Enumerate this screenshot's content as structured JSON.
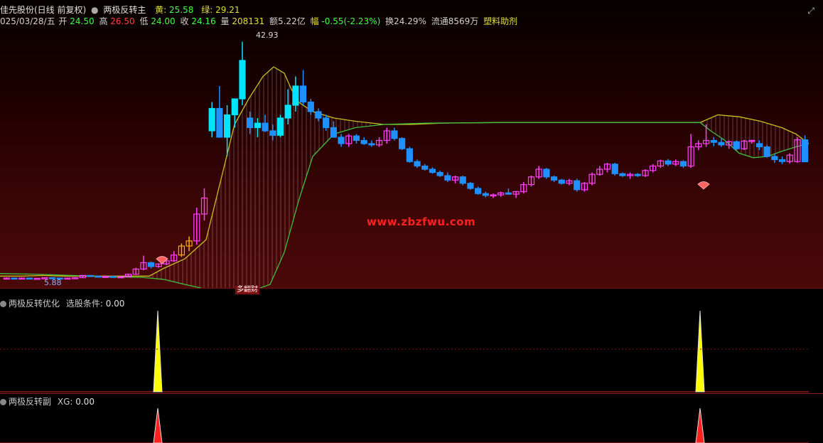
{
  "header": {
    "stock_name": "佳先股份(日线 前复权)",
    "indicator_name": "两极反转主",
    "yellow_label": "黄:",
    "yellow_value": "25.58",
    "green_label": "绿:",
    "green_value": "29.21",
    "date": "025/03/28/五",
    "open_label": "开",
    "open_value": "24.50",
    "high_label": "高",
    "high_value": "26.50",
    "low_label": "低",
    "low_value": "24.00",
    "close_label": "收",
    "close_value": "24.16",
    "volume_label": "量",
    "volume_value": "208131",
    "amount_text": "额5.22亿",
    "change_label": "幅",
    "change_value": "-0.55(-2.23%)",
    "turnover_text": "换24.29%",
    "float_text": "流通8569万",
    "sector_text": "塑料助剂"
  },
  "annotations": {
    "price_high": "42.93",
    "price_low": "5.88",
    "watermark": "www.zbzfwu.com",
    "logo": "多翻财"
  },
  "panels": {
    "osc1_name": "两极反转优化",
    "osc1_label": "选股条件:",
    "osc1_value": "0.00",
    "osc2_name": "两极反转副",
    "osc2_label": "XG:",
    "osc2_value": "0.00"
  },
  "colors": {
    "up": "#ff40ff",
    "up_cyan": "#00e5ff",
    "down": "#1e90ff",
    "yellow_line": "#c8c020",
    "green_line": "#40c040",
    "stripe": "#d9a0a0",
    "spike_yellow": "#ffff00",
    "spike_red": "#ff2020",
    "base_red": "#b02020"
  },
  "chart_data": {
    "type": "candlestick",
    "y_range": [
      5.0,
      45.0
    ],
    "candles": [
      [
        7,
        5.9,
        6.1,
        5.9,
        6.0
      ],
      [
        7,
        6.0,
        6.0,
        5.9,
        5.95
      ],
      [
        7,
        5.95,
        6.05,
        5.9,
        6.0
      ],
      [
        7,
        6.0,
        6.0,
        5.85,
        5.9
      ],
      [
        7,
        5.9,
        6.0,
        5.88,
        5.95
      ],
      [
        7,
        5.95,
        6.1,
        5.9,
        6.05
      ],
      [
        7,
        6.05,
        6.1,
        5.95,
        6.0
      ],
      [
        7,
        6.0,
        6.05,
        5.9,
        5.95
      ],
      [
        7,
        5.95,
        6.0,
        5.9,
        6.0
      ],
      [
        7,
        6.0,
        6.1,
        5.95,
        6.05
      ],
      [
        7,
        6.05,
        6.5,
        6.0,
        6.4
      ],
      [
        7,
        6.4,
        6.45,
        6.2,
        6.3
      ],
      [
        7,
        6.3,
        6.35,
        6.1,
        6.2
      ],
      [
        7,
        6.2,
        6.3,
        6.1,
        6.25
      ],
      [
        7,
        6.25,
        6.3,
        6.1,
        6.15
      ],
      [
        7,
        6.15,
        6.25,
        6.05,
        6.2
      ],
      [
        7,
        6.2,
        6.7,
        6.15,
        6.6
      ],
      [
        7,
        6.6,
        7.6,
        6.5,
        7.4
      ],
      [
        7,
        7.4,
        9.5,
        7.2,
        8.4
      ],
      [
        7,
        8.4,
        8.6,
        7.5,
        7.8
      ],
      [
        7,
        7.8,
        8.3,
        7.6,
        8.2
      ],
      [
        7,
        8.2,
        8.9,
        8.0,
        8.7
      ],
      [
        7,
        8.7,
        10.2,
        8.5,
        9.6
      ],
      [
        7,
        9.6,
        11.4,
        9.3,
        11.0
      ],
      [
        7,
        11.0,
        12.5,
        10.2,
        11.8
      ],
      [
        7,
        11.8,
        17.0,
        11.2,
        16.0
      ],
      [
        7,
        16.0,
        20.0,
        15.0,
        18.5
      ],
      [
        7,
        29.0,
        33.5,
        28.0,
        32.5
      ],
      [
        7,
        32.5,
        36.0,
        30.0,
        28.0
      ],
      [
        7,
        28.0,
        33.0,
        25.0,
        31.5
      ],
      [
        7,
        31.5,
        34.0,
        29.5,
        34.0
      ],
      [
        7,
        34.0,
        42.93,
        33.0,
        40.0
      ],
      [
        7,
        31.0,
        32.0,
        28.5,
        29.5
      ],
      [
        7,
        29.5,
        31.0,
        28.0,
        30.2
      ],
      [
        7,
        30.2,
        31.5,
        28.8,
        29.0
      ],
      [
        7,
        29.0,
        30.0,
        27.5,
        28.3
      ],
      [
        7,
        28.3,
        31.5,
        28.0,
        31.0
      ],
      [
        7,
        31.0,
        35.5,
        30.0,
        33.0
      ],
      [
        7,
        33.0,
        37.5,
        32.0,
        36.0
      ],
      [
        7,
        36.0,
        38.5,
        33.0,
        33.5
      ],
      [
        7,
        33.5,
        34.0,
        31.5,
        32.0
      ],
      [
        7,
        32.0,
        32.5,
        30.5,
        31.0
      ],
      [
        7,
        31.0,
        31.5,
        29.0,
        29.5
      ],
      [
        7,
        29.5,
        30.5,
        28.0,
        28.0
      ],
      [
        7,
        28.0,
        28.5,
        26.5,
        27.0
      ],
      [
        7,
        27.0,
        28.5,
        26.5,
        28.2
      ],
      [
        7,
        28.2,
        28.5,
        27.0,
        27.5
      ],
      [
        7,
        27.5,
        28.0,
        26.8,
        27.0
      ],
      [
        7,
        27.0,
        27.5,
        26.5,
        26.8
      ],
      [
        7,
        26.8,
        28.0,
        26.5,
        27.5
      ],
      [
        7,
        27.5,
        29.5,
        27.0,
        29.0
      ],
      [
        7,
        29.0,
        29.5,
        27.5,
        27.8
      ],
      [
        7,
        27.8,
        28.0,
        26.0,
        26.2
      ],
      [
        7,
        26.2,
        26.5,
        24.0,
        24.2
      ],
      [
        7,
        24.2,
        24.5,
        23.2,
        23.5
      ],
      [
        7,
        23.5,
        23.8,
        22.8,
        23.0
      ],
      [
        7,
        23.0,
        23.3,
        22.3,
        22.5
      ],
      [
        7,
        22.5,
        22.8,
        21.8,
        22.0
      ],
      [
        7,
        22.0,
        22.5,
        21.0,
        21.3
      ],
      [
        7,
        21.3,
        22.0,
        20.8,
        21.8
      ],
      [
        7,
        21.8,
        22.0,
        20.5,
        20.8
      ],
      [
        7,
        20.8,
        21.0,
        19.8,
        20.0
      ],
      [
        7,
        20.0,
        20.3,
        19.0,
        19.2
      ],
      [
        7,
        19.2,
        19.5,
        18.6,
        18.9
      ],
      [
        7,
        18.9,
        19.2,
        18.5,
        19.0
      ],
      [
        7,
        19.0,
        19.5,
        18.7,
        19.3
      ],
      [
        7,
        19.3,
        20.0,
        19.0,
        19.1
      ],
      [
        7,
        19.1,
        19.6,
        18.5,
        19.5
      ],
      [
        7,
        19.5,
        21.0,
        19.2,
        20.6
      ],
      [
        7,
        20.6,
        22.0,
        20.3,
        21.8
      ],
      [
        7,
        21.8,
        23.5,
        21.5,
        23.0
      ],
      [
        7,
        23.0,
        23.2,
        21.5,
        21.8
      ],
      [
        7,
        21.8,
        22.0,
        21.0,
        21.3
      ],
      [
        7,
        21.3,
        21.5,
        20.6,
        20.8
      ],
      [
        7,
        20.8,
        21.5,
        20.5,
        21.2
      ],
      [
        7,
        21.2,
        21.5,
        19.5,
        19.8
      ],
      [
        7,
        19.8,
        21.0,
        19.5,
        20.8
      ],
      [
        7,
        20.8,
        22.5,
        20.5,
        22.2
      ],
      [
        7,
        22.2,
        23.5,
        22.0,
        23.0
      ],
      [
        7,
        23.0,
        24.0,
        22.5,
        23.8
      ],
      [
        7,
        23.8,
        24.0,
        22.0,
        22.3
      ],
      [
        7,
        22.3,
        22.5,
        21.8,
        22.0
      ],
      [
        7,
        22.0,
        22.5,
        21.5,
        22.2
      ],
      [
        7,
        22.2,
        22.4,
        21.8,
        22.0
      ],
      [
        7,
        22.0,
        23.0,
        21.8,
        22.8
      ],
      [
        7,
        22.8,
        23.8,
        22.5,
        23.5
      ],
      [
        7,
        23.5,
        24.5,
        23.2,
        24.3
      ],
      [
        7,
        24.3,
        24.6,
        23.5,
        23.8
      ],
      [
        7,
        23.8,
        24.5,
        23.5,
        24.2
      ],
      [
        7,
        24.2,
        24.4,
        23.2,
        23.5
      ],
      [
        7,
        23.5,
        28.5,
        23.2,
        26.5
      ],
      [
        7,
        26.5,
        27.5,
        26.0,
        27.0
      ],
      [
        7,
        27.0,
        30.0,
        26.5,
        27.5
      ],
      [
        7,
        27.5,
        28.0,
        26.6,
        27.2
      ],
      [
        7,
        27.2,
        27.8,
        26.5,
        26.8
      ],
      [
        7,
        26.8,
        27.5,
        26.2,
        27.3
      ],
      [
        7,
        27.3,
        27.5,
        26.0,
        26.2
      ],
      [
        7,
        26.2,
        27.6,
        26.0,
        27.4
      ],
      [
        7,
        27.4,
        27.6,
        27.0,
        27.5
      ],
      [
        7,
        27.0,
        27.5,
        26.0,
        26.5
      ],
      [
        7,
        26.5,
        26.8,
        24.8,
        25.0
      ],
      [
        7,
        25.0,
        25.5,
        24.0,
        24.5
      ],
      [
        7,
        24.5,
        25.0,
        23.8,
        24.2
      ],
      [
        7,
        24.2,
        25.5,
        23.9,
        25.2
      ],
      [
        7,
        24.2,
        28.0,
        24.0,
        27.6
      ],
      [
        7,
        27.6,
        28.3,
        25.0,
        24.16
      ]
    ],
    "yellow_line": [
      [
        0,
        6.3
      ],
      [
        30,
        6.3
      ],
      [
        60,
        6.4
      ],
      [
        90,
        6.3
      ],
      [
        120,
        6.3
      ],
      [
        150,
        6.3
      ],
      [
        180,
        6.3
      ],
      [
        210,
        6.3
      ],
      [
        230,
        7.5
      ],
      [
        260,
        9.0
      ],
      [
        290,
        12.0
      ],
      [
        310,
        21.0
      ],
      [
        330,
        30.0
      ],
      [
        350,
        34.0
      ],
      [
        370,
        37.5
      ],
      [
        385,
        39.0
      ],
      [
        400,
        38.0
      ],
      [
        410,
        35.5
      ],
      [
        420,
        33.5
      ],
      [
        440,
        32.0
      ],
      [
        470,
        31.0
      ],
      [
        500,
        30.5
      ],
      [
        540,
        30.0
      ],
      [
        580,
        30.0
      ],
      [
        620,
        30.2
      ],
      [
        700,
        30.3
      ],
      [
        800,
        30.3
      ],
      [
        900,
        30.3
      ],
      [
        985,
        30.3
      ],
      [
        1010,
        31.5
      ],
      [
        1040,
        31.2
      ],
      [
        1070,
        30.5
      ],
      [
        1100,
        29.5
      ],
      [
        1120,
        28.5
      ],
      [
        1138,
        27.0
      ]
    ],
    "green_line": [
      [
        0,
        6.7
      ],
      [
        50,
        6.6
      ],
      [
        100,
        6.4
      ],
      [
        150,
        6.2
      ],
      [
        200,
        6.1
      ],
      [
        230,
        5.8
      ],
      [
        260,
        5.0
      ],
      [
        300,
        4.0
      ],
      [
        320,
        3.8
      ],
      [
        350,
        3.8
      ],
      [
        380,
        5.0
      ],
      [
        400,
        10.0
      ],
      [
        420,
        18.0
      ],
      [
        440,
        25.0
      ],
      [
        470,
        28.5
      ],
      [
        500,
        29.5
      ],
      [
        540,
        30.0
      ],
      [
        600,
        30.2
      ],
      [
        700,
        30.3
      ],
      [
        800,
        30.3
      ],
      [
        900,
        30.3
      ],
      [
        985,
        30.3
      ],
      [
        1000,
        29.0
      ],
      [
        1020,
        27.5
      ],
      [
        1040,
        25.5
      ],
      [
        1060,
        24.8
      ],
      [
        1080,
        25.0
      ],
      [
        1100,
        25.8
      ],
      [
        1120,
        26.5
      ],
      [
        1138,
        27.0
      ]
    ],
    "osc1_spikes": [
      222,
      985
    ],
    "osc2_spikes": [
      222,
      985
    ]
  }
}
